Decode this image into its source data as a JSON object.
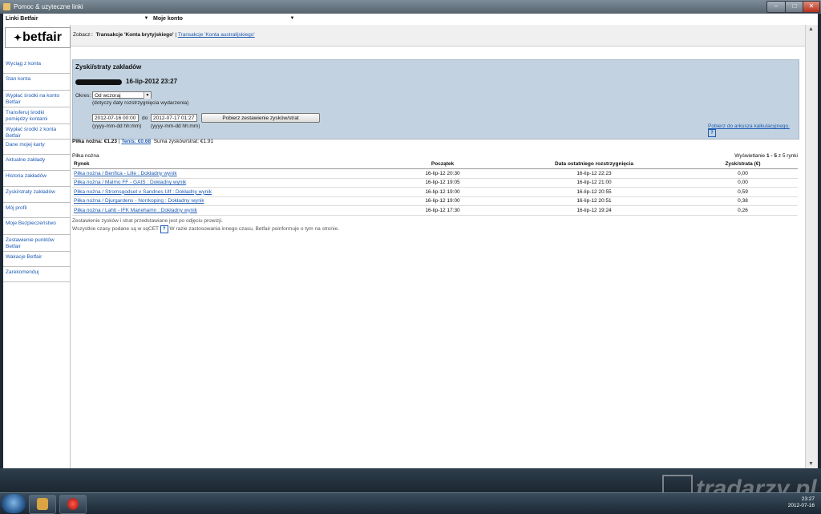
{
  "window": {
    "title": "Pomoc & uzyteczne linki",
    "controls": {
      "minimize": "–",
      "maximize": "□",
      "close": "✕"
    }
  },
  "combos": {
    "left": "Linki Betfair",
    "right": "Moje konto"
  },
  "logo": {
    "text": "betfair",
    "icon": "star-logo-icon"
  },
  "sidebar": {
    "items": [
      {
        "label": "Wyciąg z konta"
      },
      {
        "label": "Stan konta"
      },
      {
        "label": "Wypłać środki na konto Betfair"
      },
      {
        "label": "Transferuj środki pomiędzy kontami"
      },
      {
        "label": "Wypłać środki z konta Betfair"
      },
      {
        "label": "Dane mojej karty"
      },
      {
        "label": "Aktualne zakłady"
      },
      {
        "label": "Historia zakładów"
      },
      {
        "label": "Zyski/straty zakładów"
      },
      {
        "label": "Mój profil"
      },
      {
        "label": "Moje Bezpieczeństwo"
      },
      {
        "label": "Zestawienie punktów Betfair"
      },
      {
        "label": "Wakacje Betfair"
      },
      {
        "label": "Zarekomenduj"
      }
    ],
    "active_index": 8
  },
  "breadcrumb": {
    "prefix": "Zobacz::",
    "current": "Transakcje 'Konta brytyjskiego'",
    "separator": "|",
    "link": "Transakcje 'Konta australijskiego'"
  },
  "panel": {
    "title": "Zyski/straty zakładów",
    "datetime": "16-lip-2012 23:27",
    "period_label": "Okres:",
    "period_value": "Od wczoraj",
    "period_note": "(dotyczy daty rozstrzygnięcia wydarzenia)",
    "from_value": "2012-07-16 00:00",
    "to_label": "do",
    "to_value": "2012-07-17 01:27",
    "format_hint": "(yyyy-mm-dd hh:mm)",
    "fetch_button": "Pobierz zestawienie zysków/strat",
    "download_link": "Pobierz do arkusza kalkulacyjnego.",
    "help": "?"
  },
  "summary": {
    "football": "Piłka nożna: €1.23",
    "sep": "|",
    "tennis": "Tenis: €0.68",
    "total": "Suma zysków/strat:  €1.91"
  },
  "results": {
    "section": "Piłka nożna",
    "showing_prefix": "Wyświetlanie",
    "showing_range": "1 - 5",
    "showing_suffix": "z 5 rynki",
    "columns": [
      "Rynek",
      "Początek",
      "Data ostatniego rozstrzygnięcia",
      "Zysk/strata (€)"
    ],
    "rows": [
      {
        "market": "Piłka nożna / Benfica - Lille : Dokładny wynik",
        "start": "16-lip-12 20:30",
        "settled": "16-lip-12 22:23",
        "pl": "0,00"
      },
      {
        "market": "Piłka nożna / Malmo FF - GAIS : Dokładny wynik",
        "start": "16-lip-12 19:05",
        "settled": "16-lip-12 21:00",
        "pl": "0,00"
      },
      {
        "market": "Piłka nożna / Stromsgodset v Sandnes Ulf : Dokładny wynik",
        "start": "16-lip-12 19:00",
        "settled": "16-lip-12 20:55",
        "pl": "0,59"
      },
      {
        "market": "Piłka nożna / Djurgardens - Norrkoping : Dokładny wynik",
        "start": "16-lip-12 19:00",
        "settled": "16-lip-12 20:51",
        "pl": "0,38"
      },
      {
        "market": "Piłka nożna / Lahti - IFK Mariehamn : Dokładny wynik",
        "start": "16-lip-12 17:30",
        "settled": "16-lip-12 19:24",
        "pl": "0,26"
      }
    ]
  },
  "notes": {
    "line1": "Zestawienie zysków i strat przedstawiane jest po odjęciu prowizji.",
    "line2a": "Wszystkie czasy podane są w sqCET",
    "line2b": "W razie zastosowania innego czasu, Betfair poinformuje o tym na stronie."
  },
  "taskbar": {
    "time": "23:27",
    "date": "2012-07-16"
  },
  "watermark": "tradarzy.pl"
}
